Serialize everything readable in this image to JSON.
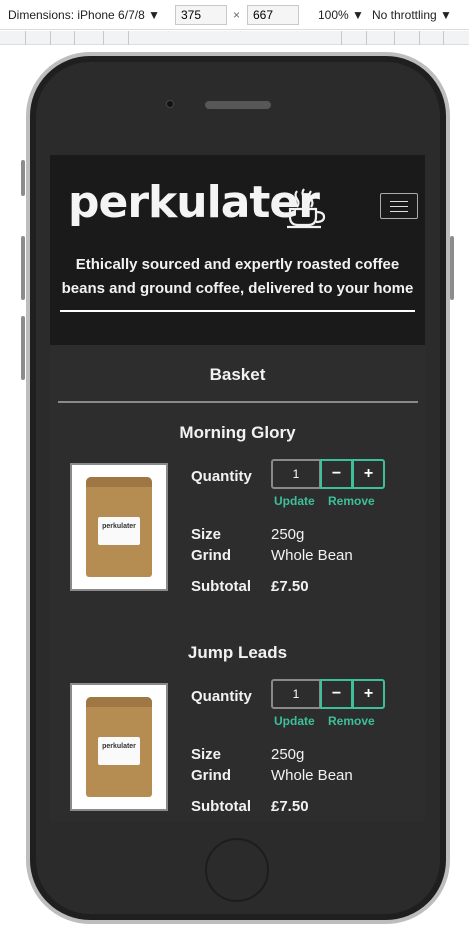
{
  "devtools": {
    "dimensions_label": "Dimensions: iPhone 6/7/8",
    "width": "375",
    "height": "667",
    "zoom": "100%",
    "throttling": "No throttling"
  },
  "site": {
    "logo": "perkulater",
    "tagline": "Ethically sourced and expertly roasted coffee beans and ground coffee, delivered to your home",
    "menu_icon": "hamburger-icon",
    "logo_icon": "coffee-cup-icon"
  },
  "basket": {
    "title": "Basket",
    "labels": {
      "quantity": "Quantity",
      "size": "Size",
      "grind": "Grind",
      "subtotal": "Subtotal",
      "update": "Update",
      "remove": "Remove",
      "minus": "−",
      "plus": "+"
    },
    "items": [
      {
        "name": "Morning Glory",
        "quantity": "1",
        "size": "250g",
        "grind": "Whole Bean",
        "subtotal": "£7.50"
      },
      {
        "name": "Jump Leads",
        "quantity": "1",
        "size": "250g",
        "grind": "Whole Bean",
        "subtotal": "£7.50"
      }
    ]
  },
  "colors": {
    "accent": "#3dbf9a",
    "background": "#2d2d2d",
    "header": "#1a1a1a"
  }
}
